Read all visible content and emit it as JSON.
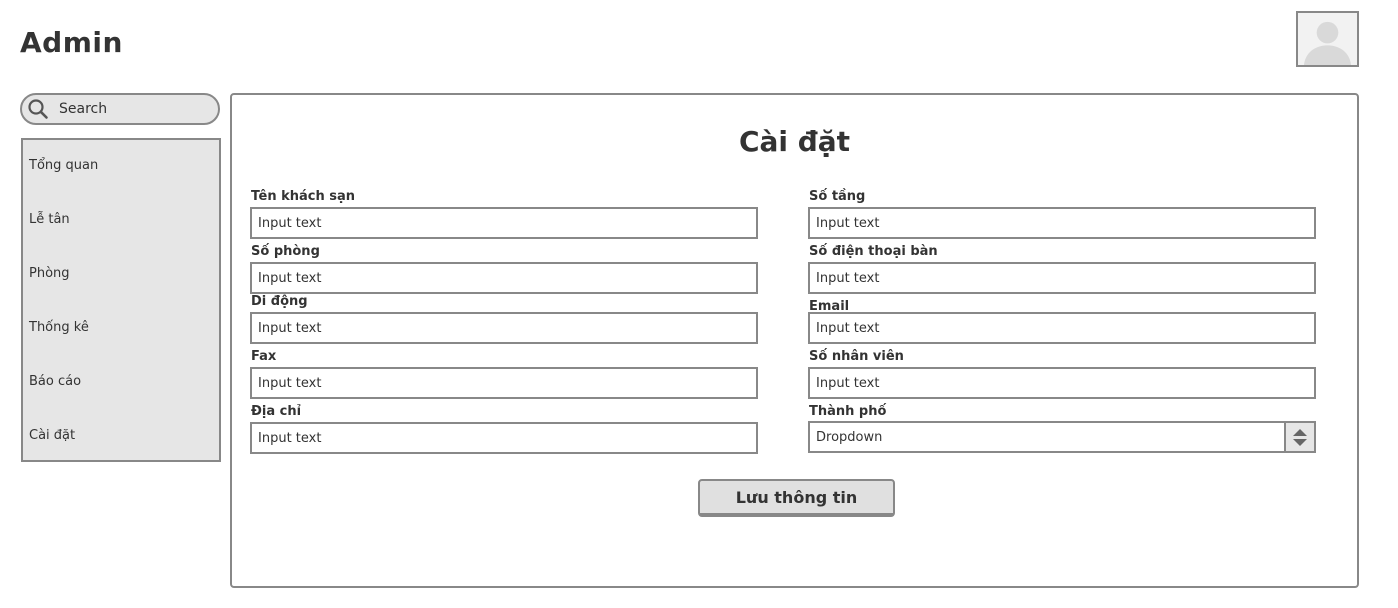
{
  "header": {
    "title": "Admin",
    "avatar_icon": "user-avatar-icon"
  },
  "search": {
    "placeholder": "Search",
    "icon": "search-icon"
  },
  "sidebar": {
    "items": [
      {
        "label": "Tổng quan"
      },
      {
        "label": "Lễ tân"
      },
      {
        "label": "Phòng"
      },
      {
        "label": "Thống kê"
      },
      {
        "label": "Báo cáo"
      },
      {
        "label": "Cài đặt"
      }
    ]
  },
  "settings": {
    "title": "Cài đặt",
    "fields": {
      "hotel_name": {
        "label": "Tên khách sạn",
        "placeholder": "Input text"
      },
      "floors": {
        "label": "Số tầng",
        "placeholder": "Input text"
      },
      "rooms": {
        "label": "Số phòng",
        "placeholder": "Input text"
      },
      "landline": {
        "label": "Số điện thoại bàn",
        "placeholder": "Input text"
      },
      "mobile": {
        "label": "Di động",
        "placeholder": "Input text"
      },
      "email": {
        "label": "Email",
        "placeholder": "Input text"
      },
      "fax": {
        "label": "Fax",
        "placeholder": "Input text"
      },
      "staff_count": {
        "label": "Số nhân viên",
        "placeholder": "Input text"
      },
      "address": {
        "label": "Địa chỉ",
        "placeholder": "Input text"
      },
      "city": {
        "label": "Thành phố",
        "value": "Dropdown"
      }
    },
    "save_label": "Lưu thông tin"
  },
  "colors": {
    "border": "#888888",
    "panel_fill": "#e6e6e6",
    "text": "#333333"
  }
}
